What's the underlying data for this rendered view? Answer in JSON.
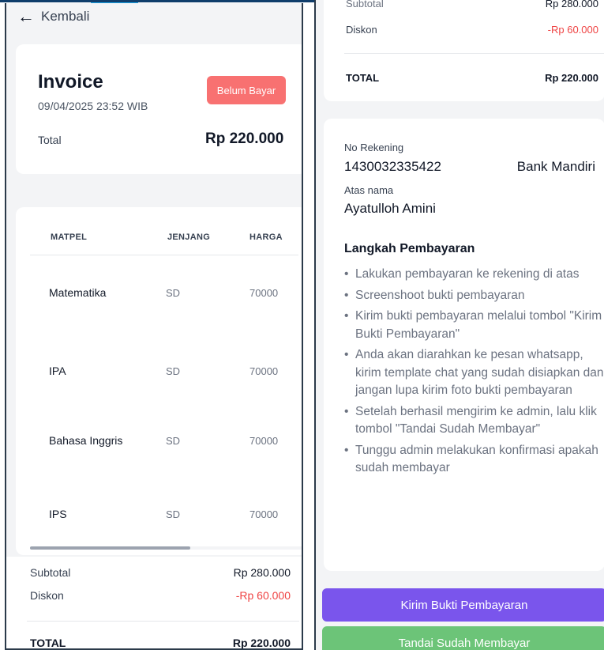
{
  "left": {
    "back_label": "Kembali",
    "invoice": {
      "title": "Invoice",
      "date": "09/04/2025 23:52 WIB",
      "status": "Belum Bayar",
      "total_label": "Total",
      "total_value": "Rp 220.000"
    },
    "table": {
      "headers": [
        "MATPEL",
        "JENJANG",
        "HARGA"
      ],
      "rows": [
        {
          "subject": "Matematika",
          "level": "SD",
          "price": "70000"
        },
        {
          "subject": "IPA",
          "level": "SD",
          "price": "70000"
        },
        {
          "subject": "Bahasa Inggris",
          "level": "SD",
          "price": "70000"
        },
        {
          "subject": "IPS",
          "level": "SD",
          "price": "70000"
        }
      ]
    },
    "summary": {
      "subtotal_label": "Subtotal",
      "subtotal_value": "Rp 280.000",
      "discount_label": "Diskon",
      "discount_value": "-Rp 60.000",
      "total_label": "TOTAL",
      "total_value": "Rp 220.000"
    }
  },
  "right": {
    "summary": {
      "subtotal_label": "Subtotal",
      "subtotal_value": "Rp 280.000",
      "discount_label": "Diskon",
      "discount_value": "-Rp 60.000",
      "total_label": "TOTAL",
      "total_value": "Rp 220.000"
    },
    "account": {
      "number_label": "No Rekening",
      "number": "1430032335422",
      "bank": "Bank Mandiri",
      "holder_label": "Atas nama",
      "holder": "Ayatulloh Amini"
    },
    "steps_title": "Langkah Pembayaran",
    "steps": [
      "Lakukan pembayaran ke rekening di atas",
      "Screenshoot bukti pembayaran",
      "Kirim bukti pembayaran melalui tombol \"Kirim Bukti Pembayaran\"",
      "Anda akan diarahkan ke pesan whatsapp, kirim template chat yang sudah disiapkan dan jangan lupa kirim foto bukti pembayaran",
      "Setelah berhasil mengirim ke admin, lalu klik tombol \"Tandai Sudah Membayar\"",
      "Tunggu admin melakukan konfirmasi apakah sudah membayar"
    ],
    "buttons": {
      "send_proof": "Kirim Bukti Pembayaran",
      "mark_paid": "Tandai Sudah Membayar"
    }
  },
  "colors": {
    "status_unpaid": "#f87171",
    "discount": "#ef4444",
    "primary_button": "#7a55ec",
    "success_button": "#6cc478"
  }
}
